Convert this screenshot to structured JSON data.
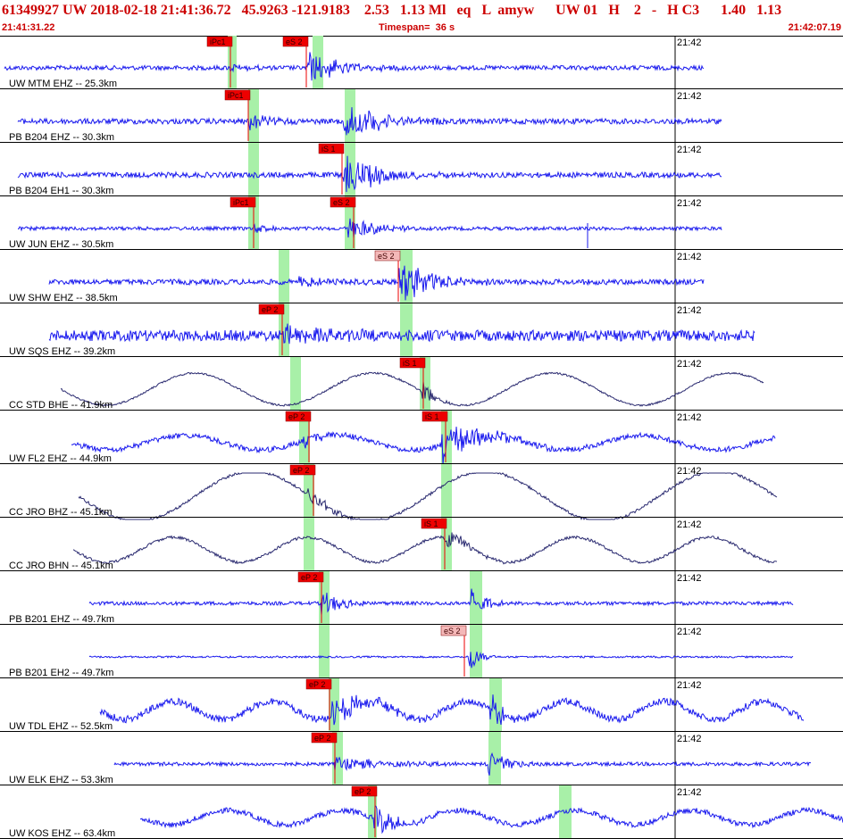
{
  "header": {
    "event_line": "61349927 UW 2018-02-18 21:41:36.72   45.9263 -121.9183    2.53   1.13 Ml   eq   L  amyw      UW 01   H    2   -   H C3      1.40   1.13",
    "start_time": "21:41:31.22",
    "timespan": "Timespan=  36 s",
    "end_time": "21:42:07.19"
  },
  "colors": {
    "trace_high": "#1a1aee",
    "trace_broadband": "#2a2a70",
    "pick_flag": "#ee0000",
    "pick_flag_light": "#f4b8b8",
    "theory_band": "#a8f0a8",
    "title": "#cc0000"
  },
  "minute_label": "21:42",
  "channels": [
    {
      "label": "UW MTM EHZ -- 25.3km",
      "picks": [
        {
          "text": "iPc1",
          "light": false
        },
        {
          "text": "eS 2",
          "light": false
        }
      ]
    },
    {
      "label": "PB B204 EHZ -- 30.3km",
      "picks": [
        {
          "text": "iPc1",
          "light": false
        }
      ]
    },
    {
      "label": "PB B204 EH1 -- 30.3km",
      "picks": [
        {
          "text": "iS 1",
          "light": false
        }
      ]
    },
    {
      "label": "UW JUN EHZ -- 30.5km",
      "picks": [
        {
          "text": "iPc1",
          "light": false
        },
        {
          "text": "eS 2",
          "light": false
        }
      ]
    },
    {
      "label": "UW SHW EHZ -- 38.5km",
      "picks": [
        {
          "text": "eS 2",
          "light": true
        }
      ]
    },
    {
      "label": "UW SQS EHZ -- 39.2km",
      "picks": [
        {
          "text": "eP 2",
          "light": false
        }
      ]
    },
    {
      "label": "CC STD BHE -- 41.9km",
      "picks": [
        {
          "text": "iS 1",
          "light": false
        }
      ]
    },
    {
      "label": "UW FL2 EHZ -- 44.9km",
      "picks": [
        {
          "text": "eP 2",
          "light": false
        },
        {
          "text": "iS 1",
          "light": false
        }
      ]
    },
    {
      "label": "CC JRO BHZ -- 45.1km",
      "picks": [
        {
          "text": "eP 2",
          "light": false
        }
      ]
    },
    {
      "label": "CC JRO BHN -- 45.1km",
      "picks": [
        {
          "text": "iS 1",
          "light": false
        }
      ]
    },
    {
      "label": "PB B201 EHZ -- 49.7km",
      "picks": [
        {
          "text": "eP 2",
          "light": false
        }
      ]
    },
    {
      "label": "PB B201 EH2 -- 49.7km",
      "picks": [
        {
          "text": "eS 2",
          "light": true
        }
      ]
    },
    {
      "label": "UW TDL EHZ -- 52.5km",
      "picks": [
        {
          "text": "eP 2",
          "light": false
        }
      ]
    },
    {
      "label": "UW ELK EHZ -- 53.3km",
      "picks": [
        {
          "text": "eP 2",
          "light": false
        }
      ]
    },
    {
      "label": "UW KOS EHZ -- 63.4km",
      "picks": [
        {
          "text": "eP 2",
          "light": false
        }
      ]
    }
  ]
}
